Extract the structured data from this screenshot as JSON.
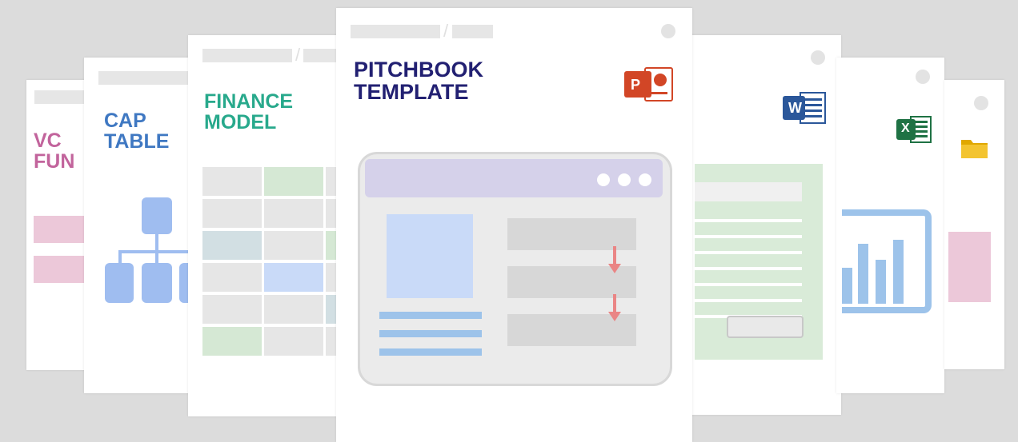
{
  "cards": {
    "vc_fund": {
      "title": "VC\nFUN"
    },
    "cap_table": {
      "title": "CAP\nTABLE"
    },
    "finance_model": {
      "title": "FINANCE\nMODEL"
    },
    "pitchbook": {
      "title": "PITCHBOOK\nTEMPLATE",
      "icon_letter": "P"
    },
    "word_doc": {
      "icon_letter": "W"
    },
    "excel_sheet": {
      "icon_letter": "X"
    },
    "folder": {}
  },
  "colors": {
    "background": "#dcdcdc",
    "vc_fund": "#c2649c",
    "cap_table": "#3f78c2",
    "finance_model": "#28a98c",
    "pitchbook": "#222072",
    "powerpoint": "#d24626",
    "word": "#2b579a",
    "excel": "#1f7244",
    "folder": "#f0c030",
    "chart_blue": "#9dc3ea"
  },
  "icons": [
    "org-chart-icon",
    "spreadsheet-grid",
    "presentation-window",
    "document-lines",
    "bar-chart-icon",
    "folder-icon",
    "powerpoint-icon",
    "word-icon",
    "excel-icon"
  ]
}
